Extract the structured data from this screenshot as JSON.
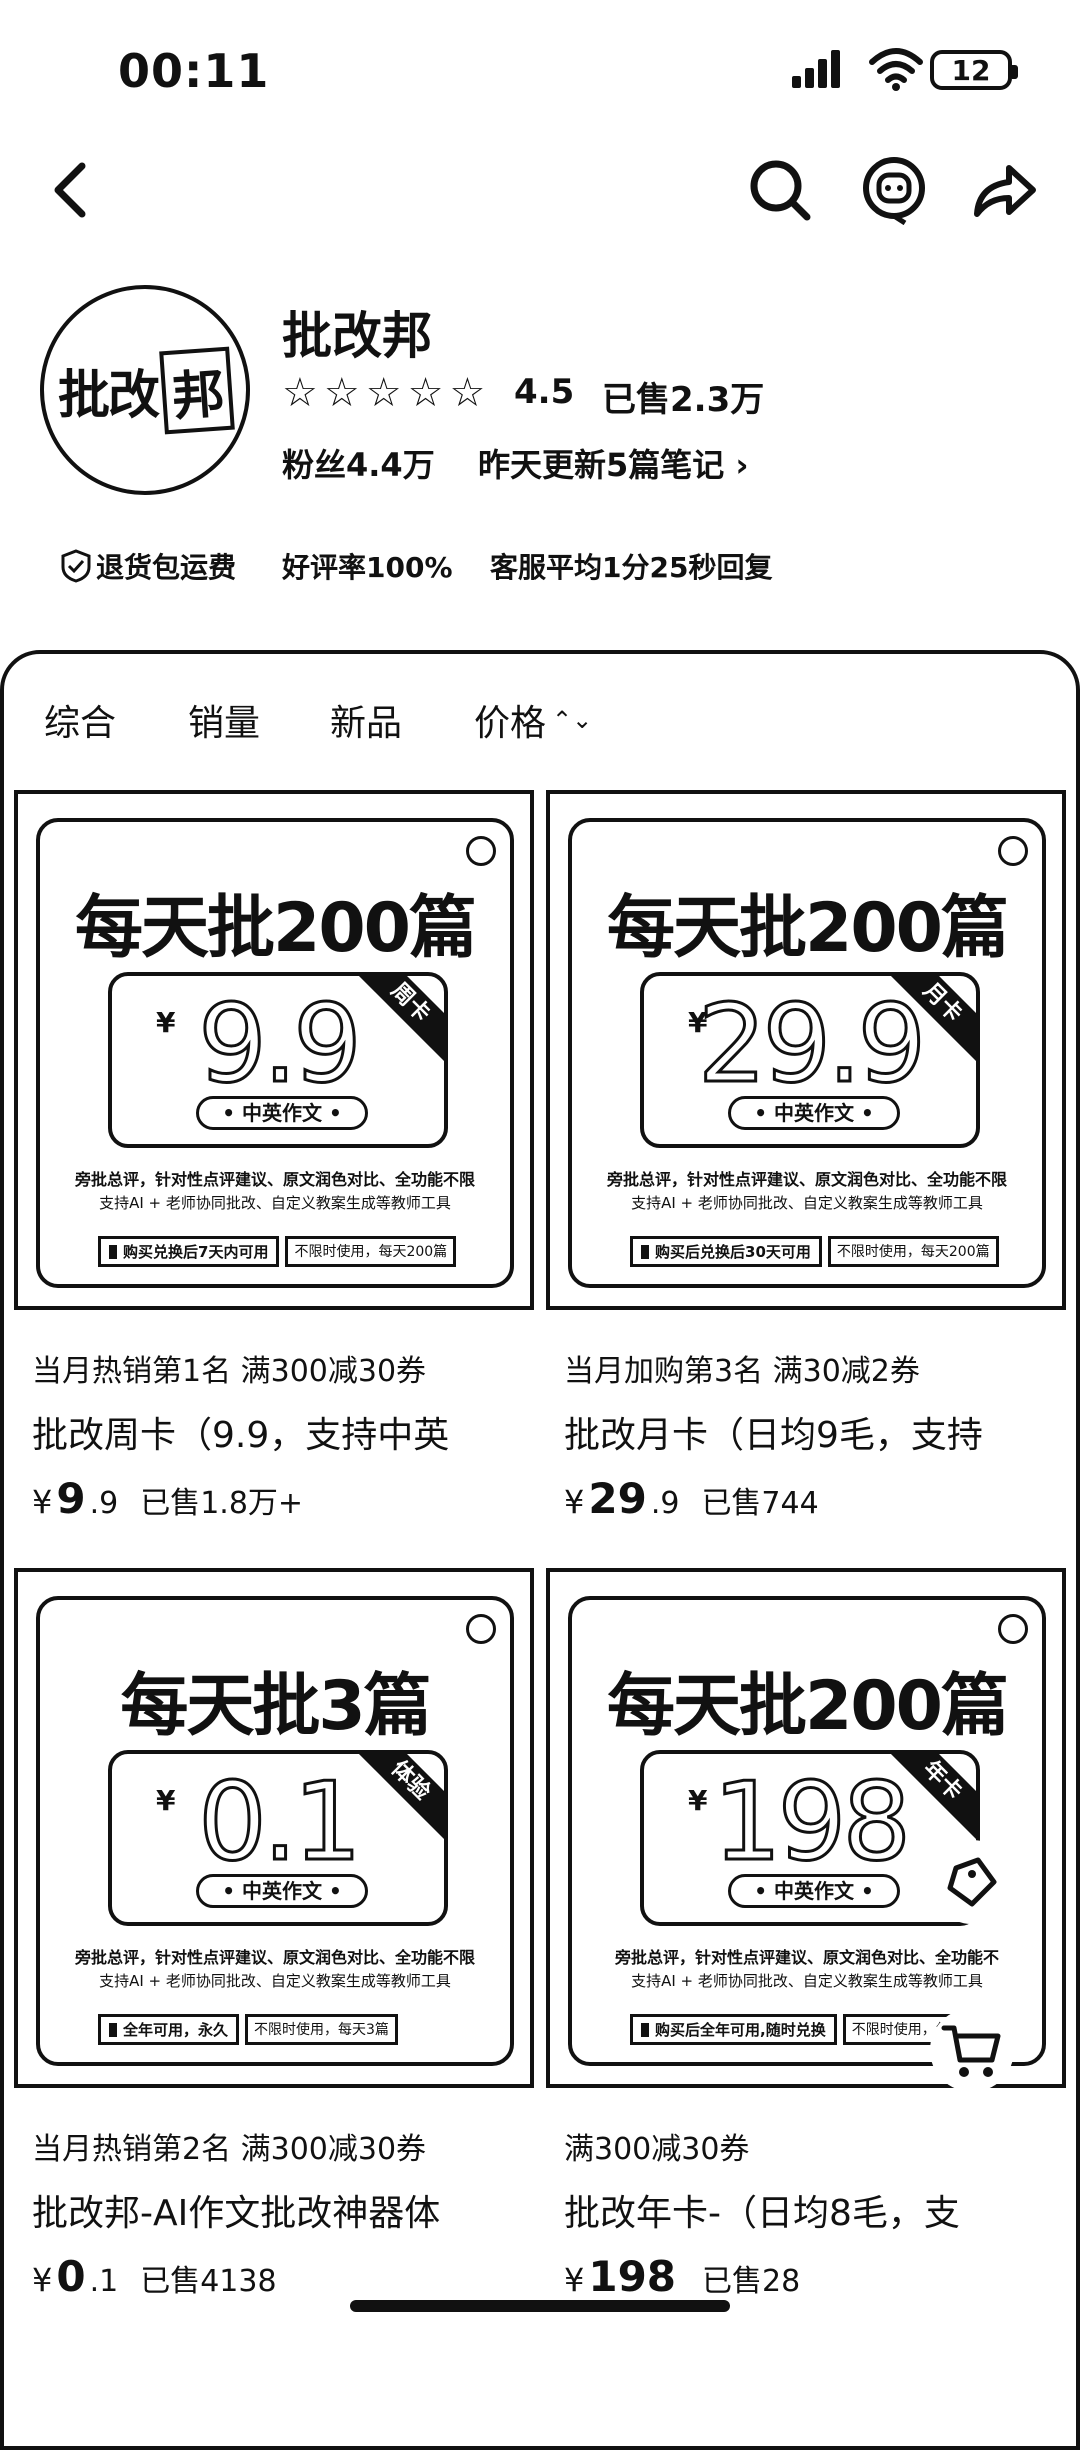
{
  "status_bar": {
    "time": "00:11",
    "battery": "12"
  },
  "store": {
    "avatar_text_a": "批改",
    "avatar_text_b": "邦",
    "name": "批改邦",
    "rating": "4.5",
    "sold": "已售2.3万",
    "fans": "粉丝4.4万",
    "update": "昨天更新5篇笔记 ›",
    "promises": [
      "退货包运费",
      "好评率100%",
      "客服平均1分25秒回复"
    ]
  },
  "sort_tabs": [
    "综合",
    "销量",
    "新品",
    "价格"
  ],
  "sort_icon": "⌃⌄",
  "products": [
    {
      "img_headline": "每天批200篇",
      "img_currency": "¥",
      "img_price": "9.9",
      "img_ribbon": "周卡",
      "img_pill": "• 中英作文 •",
      "img_desc1": "旁批总评，针对性点评建议、原文润色对比、全功能不限",
      "img_desc2": "支持AI + 老师协同批改、自定义教案生成等教师工具",
      "img_tag1": "购买兑换后7天内可用",
      "img_tag2": "不限时使用，每天200篇",
      "subline": "当月热销第1名   满300减30券",
      "title": "批改周卡（9.9，支持中英",
      "currency": "¥",
      "price_int": "9",
      "price_dec": ".9",
      "sales": "已售1.8万+"
    },
    {
      "img_headline": "每天批200篇",
      "img_currency": "¥",
      "img_price": "29.9",
      "img_ribbon": "月卡",
      "img_pill": "• 中英作文 •",
      "img_desc1": "旁批总评，针对性点评建议、原文润色对比、全功能不限",
      "img_desc2": "支持AI + 老师协同批改、自定义教案生成等教师工具",
      "img_tag1": "购买后兑换后30天可用",
      "img_tag2": "不限时使用，每天200篇",
      "subline": "当月加购第3名   满30减2券",
      "title": "批改月卡（日均9毛，支持",
      "currency": "¥",
      "price_int": "29",
      "price_dec": ".9",
      "sales": "已售744"
    },
    {
      "img_headline": "每天批3篇",
      "img_currency": "¥",
      "img_price": "0.1",
      "img_ribbon": "体验",
      "img_pill": "• 中英作文 •",
      "img_desc1": "旁批总评，针对性点评建议、原文润色对比、全功能不限",
      "img_desc2": "支持AI + 老师协同批改、自定义教案生成等教师工具",
      "img_tag1": "全年可用，永久",
      "img_tag2": "不限时使用，每天3篇",
      "subline": "当月热销第2名   满300减30券",
      "title": "批改邦-AI作文批改神器体",
      "currency": "¥",
      "price_int": "0",
      "price_dec": ".1",
      "sales": "已售4138"
    },
    {
      "img_headline": "每天批200篇",
      "img_currency": "¥",
      "img_price": "198",
      "img_ribbon": "年卡",
      "img_pill": "• 中英作文 •",
      "img_desc1": "旁批总评，针对性点评建议、原文润色对比、全功能不",
      "img_desc2": "支持AI + 老师协同批改、自定义教案生成等教师工具",
      "img_tag1": "购买后全年可用,随时兑换",
      "img_tag2": "不限时使用，每",
      "subline": "满300减30券",
      "title": "批改年卡-（日均8毛，支",
      "currency": "¥",
      "price_int": "198",
      "price_dec": "",
      "sales": "已售28"
    }
  ],
  "icons": {
    "back": "back-chevron-icon",
    "search": "search-icon",
    "service": "customer-service-icon",
    "share": "share-icon",
    "verify": "check-shield-icon",
    "coupon": "coupon-tag-icon",
    "cart": "cart-icon"
  }
}
